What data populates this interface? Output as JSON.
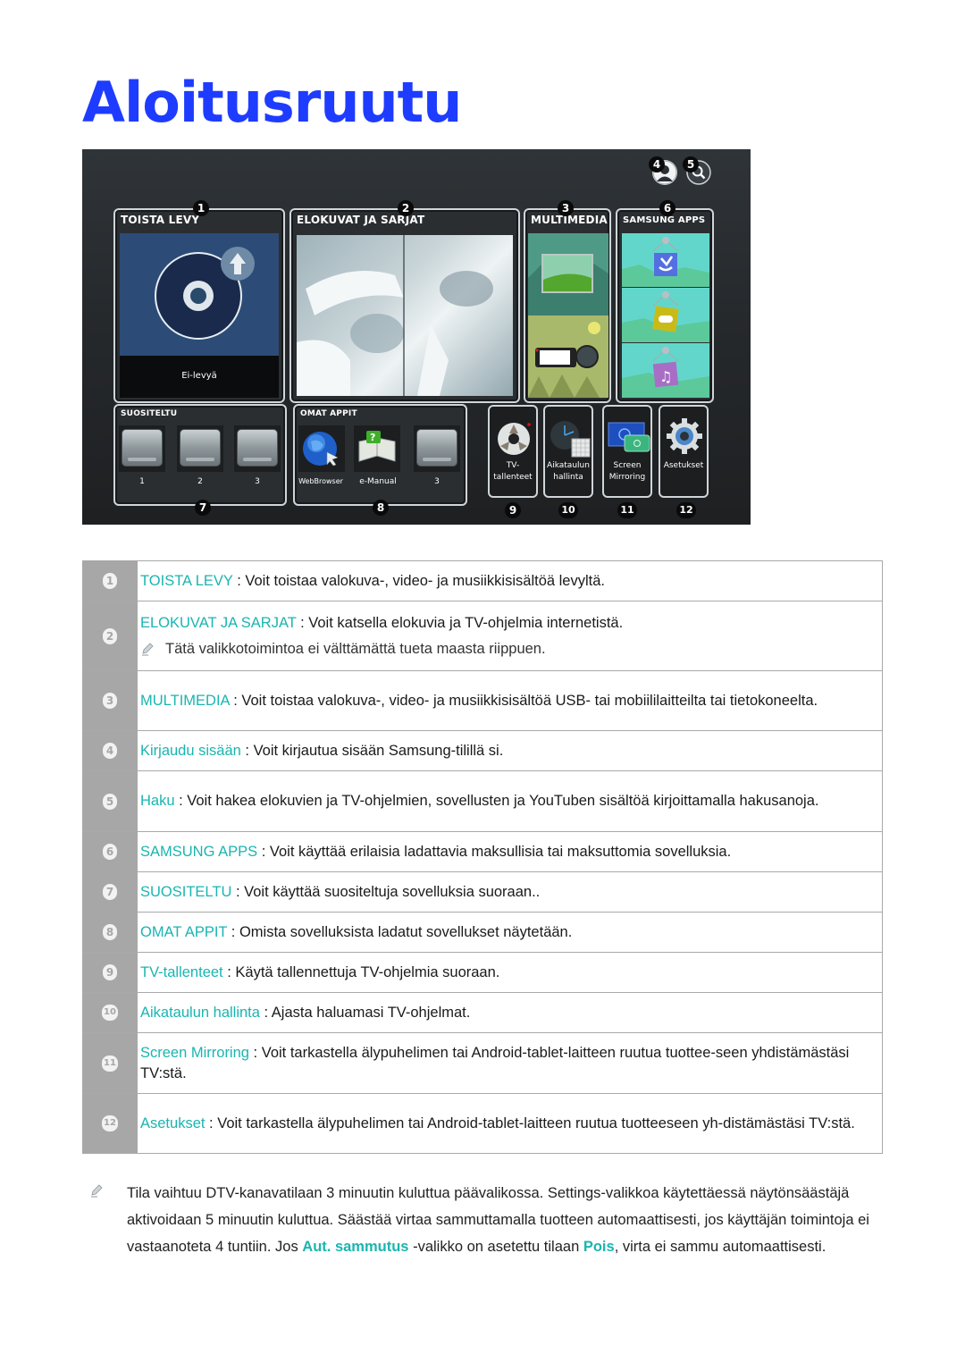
{
  "page": {
    "title": "Aloitusruutu"
  },
  "tv_screen": {
    "top_icons": [
      {
        "badge": "4",
        "icon": "user-profile-icon"
      },
      {
        "badge": "5",
        "icon": "search-icon"
      }
    ],
    "main_tiles": [
      {
        "badge": "1",
        "label": "TOISTA LEVY",
        "status": "Ei-levyä"
      },
      {
        "badge": "2",
        "label": "ELOKUVAT JA SARJAT"
      },
      {
        "badge": "3",
        "label": "MULTIMEDIA"
      },
      {
        "badge": "6",
        "label": "SAMSUNG APPS"
      }
    ],
    "suositeltu": {
      "badge": "7",
      "label": "SUOSITELTU",
      "apps": [
        "1",
        "2",
        "3"
      ]
    },
    "omat_appit": {
      "badge": "8",
      "label": "OMAT APPIT",
      "apps": [
        "WebBrowser",
        "e-Manual",
        "3"
      ]
    },
    "side_tiles": [
      {
        "badge": "9",
        "line1": "TV-",
        "line2": "tallenteet",
        "icon": "tape-reel-icon"
      },
      {
        "badge": "10",
        "line1": "Aikataulun",
        "line2": "hallinta",
        "icon": "clock-calendar-icon"
      },
      {
        "badge": "11",
        "line1": "Screen",
        "line2": "Mirroring",
        "icon": "screen-mirroring-icon"
      },
      {
        "badge": "12",
        "line1": "Asetukset",
        "line2": "",
        "icon": "gear-icon"
      }
    ]
  },
  "descriptions": [
    {
      "num": "1",
      "keyword": "TOISTA LEVY",
      "text": " : Voit toistaa valokuva-, video- ja musiikkisisältöä levyltä."
    },
    {
      "num": "2",
      "keyword": "ELOKUVAT JA SARJAT",
      "text": " : Voit katsella elokuvia ja TV-ohjelmia internetistä.",
      "note": "Tätä valikkotoimintoa ei välttämättä tueta maasta riippuen."
    },
    {
      "num": "3",
      "keyword": "MULTIMEDIA",
      "text": " : Voit toistaa valokuva-, video- ja musiikkisisältöä USB- tai mobiililaitteilta tai tietokoneelta."
    },
    {
      "num": "4",
      "keyword": "Kirjaudu sisään",
      "text": " : Voit kirjautua sisään Samsung-tilillä si."
    },
    {
      "num": "5",
      "keyword": "Haku",
      "text": " : Voit hakea elokuvien ja TV-ohjelmien, sovellusten ja YouTuben sisältöä kirjoittamalla hakusanoja."
    },
    {
      "num": "6",
      "keyword": "SAMSUNG APPS",
      "text": " : Voit käyttää erilaisia ladattavia maksullisia tai maksuttomia sovelluksia."
    },
    {
      "num": "7",
      "keyword": "SUOSITELTU",
      "text": " : Voit käyttää suositeltuja sovelluksia suoraan.."
    },
    {
      "num": "8",
      "keyword": "OMAT APPIT",
      "text": " : Omista sovelluksista ladatut sovellukset näytetään."
    },
    {
      "num": "9",
      "keyword": "TV-tallenteet",
      "text": " : Käytä tallennettuja TV-ohjelmia suoraan."
    },
    {
      "num": "10",
      "keyword": "Aikataulun hallinta",
      "text": " : Ajasta haluamasi TV-ohjelmat."
    },
    {
      "num": "11",
      "keyword": "Screen Mirroring",
      "text": " : Voit tarkastella älypuhelimen tai Android-tablet-laitteen ruutua tuottee-seen yhdistämästäsi TV:stä."
    },
    {
      "num": "12",
      "keyword": "Asetukset",
      "text": " : Voit tarkastella älypuhelimen tai Android-tablet-laitteen ruutua tuotteeseen yh-distämästäsi TV:stä."
    }
  ],
  "footnote": {
    "part1": "Tila vaihtuu DTV-kanavatilaan 3 minuutin kuluttua päävalikossa. Settings-valikkoa käytettäessä näytönsäästäjä aktivoidaan 5 minuutin kuluttua. Säästää virtaa sammuttamalla tuotteen automaattisesti, jos käyttäjän toimintoja ei vastaanoteta 4 tuntiin. Jos ",
    "kw1": "Aut. sammutus",
    "part2": " -valikko on asetettu tilaan ",
    "kw2": "Pois",
    "part3": ", virta ei sammu automaattisesti."
  },
  "colors": {
    "title": "#1e3cff",
    "keyword": "#1ab5b0",
    "number_column": "#a7a7a7"
  }
}
